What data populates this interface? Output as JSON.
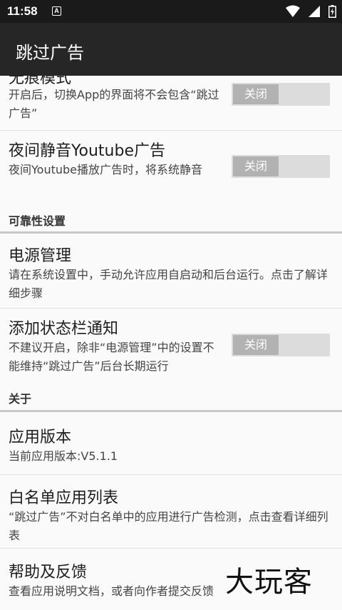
{
  "status_bar": {
    "time": "11:58",
    "notification_icon_letter": "A",
    "icons": [
      "wifi-icon",
      "signal-icon",
      "battery-icon"
    ]
  },
  "app_bar": {
    "title": "跳过广告"
  },
  "prefs": [
    {
      "title": "无痕模式",
      "summary": "开启后，切换App的界面将不会包含“跳过广告”",
      "switch_label": "关闭"
    },
    {
      "title": "夜间静音Youtube广告",
      "summary": "夜间Youtube播放广告时，将系统静音",
      "switch_label": "关闭"
    },
    {
      "title": "电源管理",
      "summary": "请在系统设置中，手动允许应用自启动和后台运行。点击了解详细步骤"
    },
    {
      "title": "添加状态栏通知",
      "summary": "不建议开启，除非“电源管理”中的设置不能维持“跳过广告”后台长期运行",
      "switch_label": "关闭"
    },
    {
      "title": "应用版本",
      "summary": "当前应用版本:V5.1.1"
    },
    {
      "title": "白名单应用列表",
      "summary": "“跳过广告”不对白名单中的应用进行广告检测，点击查看详细列表"
    },
    {
      "title": "帮助及反馈",
      "summary": "查看应用说明文档，或者向作者提交反馈"
    }
  ],
  "categories": {
    "reliability": "可靠性设置",
    "about": "关于"
  },
  "watermark": "大玩客",
  "colors": {
    "status_bar": "#1a1a1a",
    "app_bar": "#262626",
    "background": "#fafafa",
    "switch_track": "#dcdcdc",
    "switch_knob": "#b2b2b2"
  }
}
